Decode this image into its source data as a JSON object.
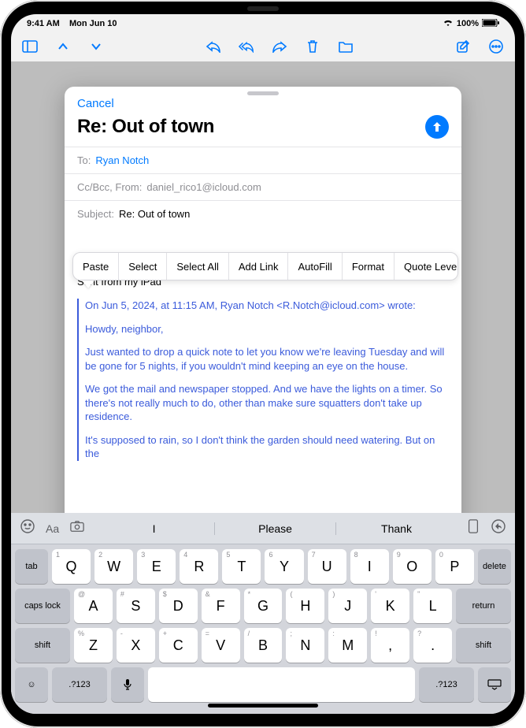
{
  "status": {
    "time": "9:41 AM",
    "date": "Mon Jun 10",
    "battery": "100%"
  },
  "compose": {
    "cancel": "Cancel",
    "title": "Re: Out of town",
    "to_label": "To:",
    "to_recipient": "Ryan Notch",
    "ccbcc_label": "Cc/Bcc, From:",
    "from_addr": "daniel_rico1@icloud.com",
    "subject_label": "Subject:",
    "subject_value": "Re: Out of town",
    "signature": "Sent from my iPad",
    "quote_meta": "On Jun 5, 2024, at 11:15 AM, Ryan Notch <R.Notch@icloud.com> wrote:",
    "quote_p1": "Howdy, neighbor,",
    "quote_p2": "Just wanted to drop a quick note to let you know we're leaving Tuesday and will be gone for 5 nights, if you wouldn't mind keeping an eye on the house.",
    "quote_p3": "We got the mail and newspaper stopped. And we have the lights on a timer. So there's not really much to do, other than make sure squatters don't take up residence.",
    "quote_p4": "It's supposed to rain, so I don't think the garden should need watering. But on the"
  },
  "popover": {
    "paste": "Paste",
    "select": "Select",
    "select_all": "Select All",
    "add_link": "Add Link",
    "autofill": "AutoFill",
    "format": "Format",
    "quote_level": "Quote Level"
  },
  "suggestions": {
    "s1": "I",
    "s2": "Please",
    "s3": "Thank",
    "aa": "Aa"
  },
  "keys": {
    "row1": [
      "Q",
      "W",
      "E",
      "R",
      "T",
      "Y",
      "U",
      "I",
      "O",
      "P"
    ],
    "row1alt": [
      "1",
      "2",
      "3",
      "4",
      "5",
      "6",
      "7",
      "8",
      "9",
      "0"
    ],
    "row2": [
      "A",
      "S",
      "D",
      "F",
      "G",
      "H",
      "J",
      "K",
      "L"
    ],
    "row2alt": [
      "@",
      "#",
      "$",
      "&",
      "*",
      "(",
      ")",
      "'",
      "\""
    ],
    "row3": [
      "Z",
      "X",
      "C",
      "V",
      "B",
      "N",
      "M",
      ",",
      "."
    ],
    "row3alt": [
      "%",
      "-",
      "+",
      "=",
      "/",
      ";",
      ":",
      "!",
      "?"
    ],
    "tab": "tab",
    "delete": "delete",
    "caps": "caps lock",
    "return": "return",
    "shift": "shift",
    "numsym": ".?123"
  }
}
